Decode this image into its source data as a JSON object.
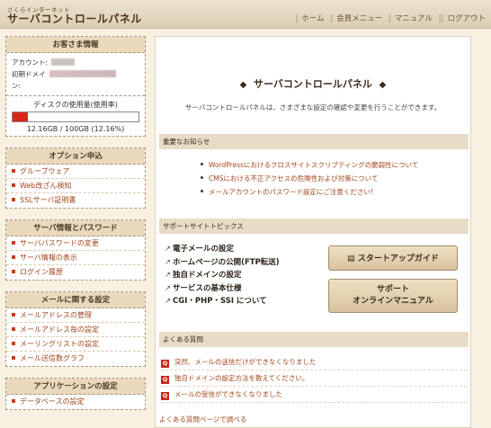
{
  "header": {
    "logo_small": "さくらインターネット",
    "logo_big": "サーバコントロールパネル",
    "nav": [
      "ホーム",
      "会員メニュー",
      "マニュアル",
      "ログアウト"
    ]
  },
  "account": {
    "heading": "お客さま情報",
    "account_label": "アカウント:",
    "domain_label_1": "初期ドメイ",
    "domain_label_2": "ン:",
    "disk_heading": "ディスクの使用量(使用率)",
    "disk_usage_text": "12.16GB / 100GB (12.16%)",
    "disk_usage_fraction": 0.1216
  },
  "sidebar": {
    "options": {
      "heading": "オプション申込",
      "items": [
        "グループウェア",
        "Web改ざん検知",
        "SSLサーバ証明書"
      ]
    },
    "server": {
      "heading": "サーバ情報とパスワード",
      "items": [
        "サーバパスワードの変更",
        "サーバ情報の表示",
        "ログイン履歴"
      ]
    },
    "mail": {
      "heading": "メールに関する設定",
      "items": [
        "メールアドレスの管理",
        "メールアドレス毎の設定",
        "メーリングリストの設定",
        "メール送信数グラフ"
      ]
    },
    "apps": {
      "heading": "アプリケーションの設定",
      "items": [
        "データベースの設定"
      ]
    }
  },
  "main": {
    "title": "サーバコントロールパネル",
    "subtitle": "サーバコントロールパネルは、さまざまな設定の確認や変更を行うことができます。",
    "news_heading": "重要なお知らせ",
    "news": [
      "WordPressにおけるクロスサイトスクリプティングの脆弱性について",
      "CMSにおける不正アクセスの危険性および対策について",
      "メールアカウントのパスワード設定にご注意ください!"
    ],
    "topics_heading": "サポートサイトトピックス",
    "topics": [
      "電子メールの設定",
      "ホームページの公開(FTP転送)",
      "独自ドメインの設定",
      "サービスの基本仕様",
      "CGI・PHP・SSI について"
    ],
    "startup_button": "スタートアップガイド",
    "manual_button_1": "サポート",
    "manual_button_2": "オンラインマニュアル",
    "faq_heading": "よくある質問",
    "faq": [
      "突然、メールの送信だけができなくなりました",
      "独自ドメインの設定方法を教えてください。",
      "メールの受信ができなくなりました"
    ],
    "faq_more": "よくある質問ページで調べる"
  }
}
